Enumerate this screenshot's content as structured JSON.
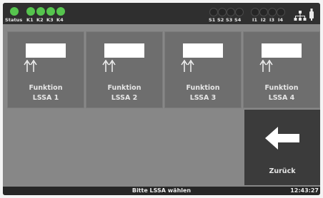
{
  "topbar": {
    "status_label": "Status",
    "k_labels": [
      "K1",
      "K2",
      "K3",
      "K4"
    ],
    "s_labels": [
      "S1",
      "S2",
      "S3",
      "S4"
    ],
    "i_labels": [
      "I1",
      "I2",
      "I3",
      "I4"
    ],
    "network_icon": "network-icon",
    "usb_icon": "usb-icon",
    "led_on_color": "#56c44e"
  },
  "tiles": [
    {
      "line1": "Funktion",
      "line2": "LSSA 1"
    },
    {
      "line1": "Funktion",
      "line2": "LSSA 2"
    },
    {
      "line1": "Funktion",
      "line2": "LSSA 3"
    },
    {
      "line1": "Funktion",
      "line2": "LSSA 4"
    }
  ],
  "back_button": {
    "label": "Zurück",
    "icon": "arrow-left-icon"
  },
  "bottombar": {
    "message": "Bitte LSSA wählen",
    "time": "12:43:27"
  }
}
